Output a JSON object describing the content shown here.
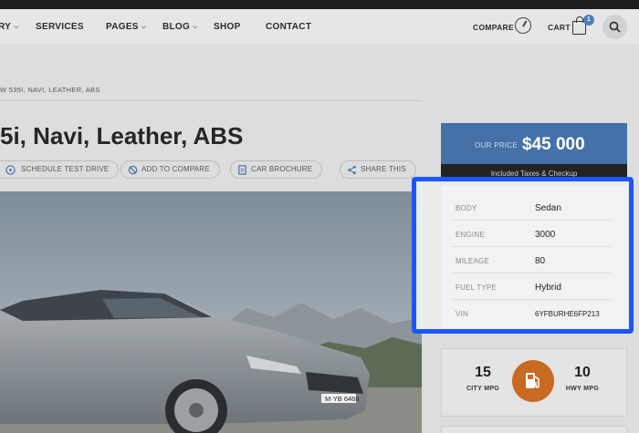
{
  "nav": {
    "items": [
      {
        "label": "RY",
        "chevron": true
      },
      {
        "label": "SERVICES",
        "chevron": false
      },
      {
        "label": "PAGES",
        "chevron": true
      },
      {
        "label": "BLOG",
        "chevron": true
      },
      {
        "label": "SHOP",
        "chevron": false
      },
      {
        "label": "CONTACT",
        "chevron": false
      }
    ],
    "compare_label": "COMPARE",
    "cart_label": "CART",
    "cart_count": "1",
    "icons": [
      "chevron-down-icon",
      "gauge-icon",
      "shopping-bag-icon",
      "search-icon"
    ]
  },
  "breadcrumb": "W 535I, NAVI, LEATHER, ABS",
  "title": "5i, Navi, Leather, ABS",
  "actions": [
    {
      "label": "SCHEDULE TEST DRIVE",
      "icon": "steering-wheel-icon"
    },
    {
      "label": "ADD TO COMPARE",
      "icon": "compare-icon"
    },
    {
      "label": "CAR BROCHURE",
      "icon": "document-icon"
    },
    {
      "label": "SHARE THIS",
      "icon": "share-icon"
    }
  ],
  "price": {
    "label": "OUR PRICE",
    "value": "$45 000",
    "note": "Included Taxes & Checkup"
  },
  "specs": [
    {
      "label": "BODY",
      "value": "Sedan"
    },
    {
      "label": "ENGINE",
      "value": "3000"
    },
    {
      "label": "MILEAGE",
      "value": "80"
    },
    {
      "label": "FUEL TYPE",
      "value": "Hybrid"
    },
    {
      "label": "VIN",
      "value": "6YFBURHE6FP213"
    }
  ],
  "mpg": {
    "city_value": "15",
    "city_label": "CITY MPG",
    "hwy_value": "10",
    "hwy_label": "HWY MPG",
    "icon": "fuel-pump-icon"
  },
  "photo": {
    "license_plate": "M·YB 6466"
  },
  "colors": {
    "price_blue": "#4571a8",
    "highlight_border": "#1e55ff",
    "fuel_orange": "#c86a22",
    "badge_blue": "#4a7fc1"
  }
}
